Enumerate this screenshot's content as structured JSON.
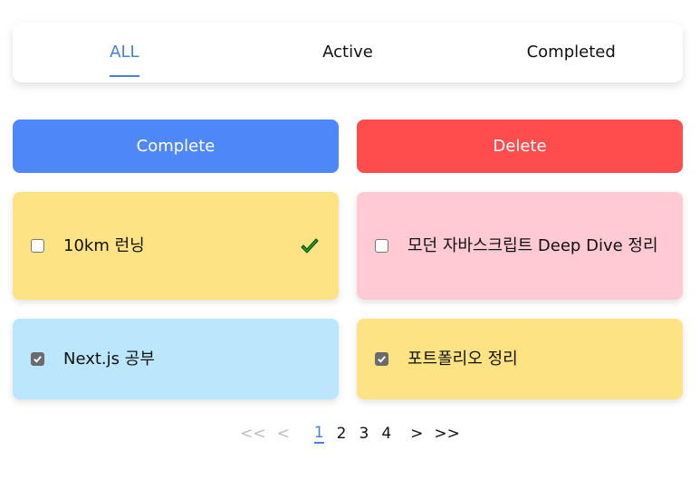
{
  "tabs": [
    {
      "label": "ALL",
      "active": true
    },
    {
      "label": "Active",
      "active": false
    },
    {
      "label": "Completed",
      "active": false
    }
  ],
  "actions": {
    "complete_label": "Complete",
    "delete_label": "Delete"
  },
  "todos": [
    {
      "text": "10km 런닝",
      "checked": false,
      "completed": true,
      "color": "#fde383"
    },
    {
      "text": "모던 자바스크립트 Deep Dive 정리",
      "checked": false,
      "completed": false,
      "color": "#ffcad3"
    },
    {
      "text": "Next.js 공부",
      "checked": true,
      "completed": false,
      "color": "#bbe6fc"
    },
    {
      "text": "포트폴리오 정리",
      "checked": true,
      "completed": false,
      "color": "#fde383"
    }
  ],
  "pagination": {
    "first": "<<",
    "prev": "<",
    "pages": [
      "1",
      "2",
      "3",
      "4"
    ],
    "current_page": "1",
    "next": ">",
    "last": ">>"
  },
  "colors": {
    "accent": "#4a7fd6",
    "complete_button": "#4e87f8",
    "delete_button": "#ff4d4d",
    "check_icon": "#2e9b2e"
  }
}
